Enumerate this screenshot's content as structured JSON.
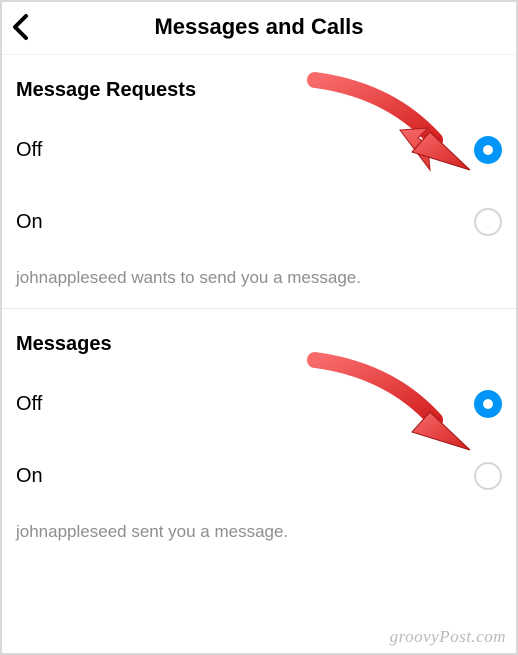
{
  "header": {
    "title": "Messages and Calls"
  },
  "sections": [
    {
      "heading": "Message Requests",
      "options": {
        "off_label": "Off",
        "on_label": "On",
        "selected": "off"
      },
      "caption": "johnappleseed wants to send you a message."
    },
    {
      "heading": "Messages",
      "options": {
        "off_label": "Off",
        "on_label": "On",
        "selected": "off"
      },
      "caption": "johnappleseed sent you a message."
    }
  ],
  "watermark": "groovyPost.com",
  "colors": {
    "accent": "#0095f6",
    "arrow": "#ed3b3b"
  }
}
